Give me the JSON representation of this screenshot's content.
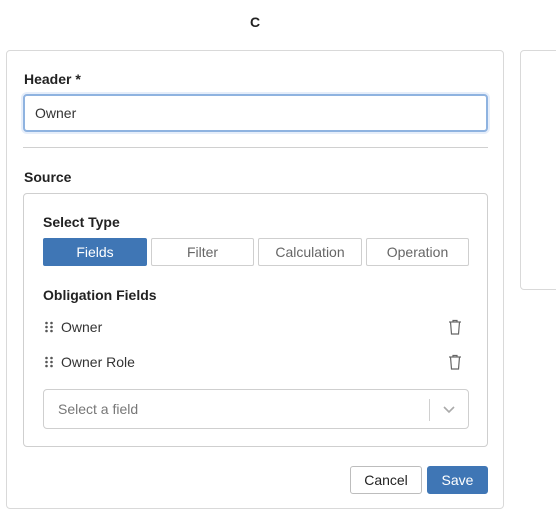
{
  "column": {
    "title": "C"
  },
  "header_field": {
    "label": "Header *",
    "value": "Owner"
  },
  "source": {
    "label": "Source",
    "select_type_label": "Select Type",
    "types": [
      {
        "label": "Fields",
        "active": true
      },
      {
        "label": "Filter",
        "active": false
      },
      {
        "label": "Calculation",
        "active": false
      },
      {
        "label": "Operation",
        "active": false
      }
    ],
    "obligation_fields_label": "Obligation Fields",
    "fields": [
      {
        "name": "Owner",
        "icons": [
          "drag-handle-icon",
          "trash-icon"
        ]
      },
      {
        "name": "Owner Role",
        "icons": [
          "drag-handle-icon",
          "trash-icon"
        ]
      }
    ],
    "select_field_placeholder": "Select a field"
  },
  "actions": {
    "cancel_label": "Cancel",
    "save_label": "Save"
  },
  "colors": {
    "primary": "#3f76b5",
    "focus_border": "#8fb3e0",
    "border": "#d9d9d9"
  }
}
